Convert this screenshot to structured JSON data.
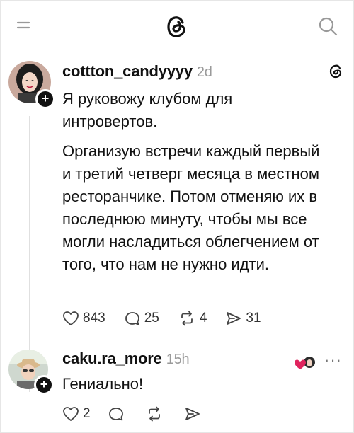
{
  "header": {
    "menu_icon": "menu-icon",
    "logo_icon": "threads-logo-icon",
    "search_icon": "search-icon"
  },
  "post": {
    "username": "cottton_candyyyy",
    "time": "2d",
    "paragraph_1": "Я руковожу клубом для интровертов.",
    "paragraph_2": "Организую встречи каждый первый и третий четверг месяца в местном ресторанчике. Потом отменяю их в последнюю минуту, чтобы мы все могли насладиться облегчением от того, что нам не нужно идти.",
    "likes": "843",
    "comments": "25",
    "reposts": "4",
    "shares": "31"
  },
  "reply": {
    "username": "caku.ra_more",
    "time": "15h",
    "text": "Гениально!",
    "likes": "2",
    "more_label": "···"
  },
  "colors": {
    "text": "#111111",
    "muted": "#9a9a9a",
    "heart_accent": "#e0245e"
  }
}
